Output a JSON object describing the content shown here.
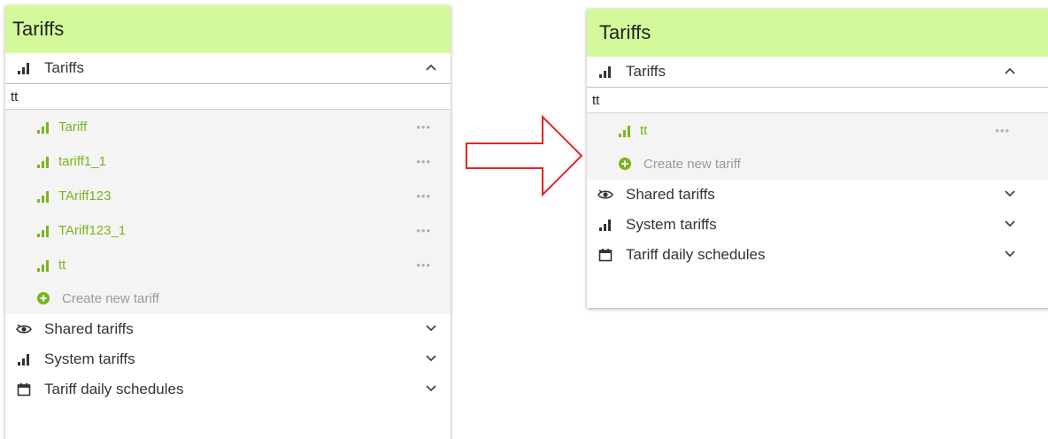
{
  "left": {
    "header": "Tariffs",
    "tariffs_section": {
      "label": "Tariffs",
      "expanded": true
    },
    "search": {
      "value": "tt"
    },
    "items": [
      {
        "label": "Tariff"
      },
      {
        "label": "tariff1_1"
      },
      {
        "label": "TAriff123"
      },
      {
        "label": "TAriff123_1"
      },
      {
        "label": "tt"
      }
    ],
    "create_label": "Create new tariff",
    "sections": [
      {
        "label": "Shared tariffs",
        "icon": "shared-icon"
      },
      {
        "label": "System tariffs",
        "icon": "bar-chart-icon"
      },
      {
        "label": "Tariff daily schedules",
        "icon": "calendar-icon"
      }
    ]
  },
  "right": {
    "header": "Tariffs",
    "tariffs_section": {
      "label": "Tariffs",
      "expanded": true
    },
    "search": {
      "value": "tt"
    },
    "items": [
      {
        "label": "tt"
      }
    ],
    "create_label": "Create new tariff",
    "sections": [
      {
        "label": "Shared tariffs",
        "icon": "shared-icon"
      },
      {
        "label": "System tariffs",
        "icon": "bar-chart-icon"
      },
      {
        "label": "Tariff daily schedules",
        "icon": "calendar-icon"
      }
    ]
  },
  "colors": {
    "header_bg": "#d4f99a",
    "accent_green": "#79b51c",
    "arrow_red": "#e52421"
  }
}
